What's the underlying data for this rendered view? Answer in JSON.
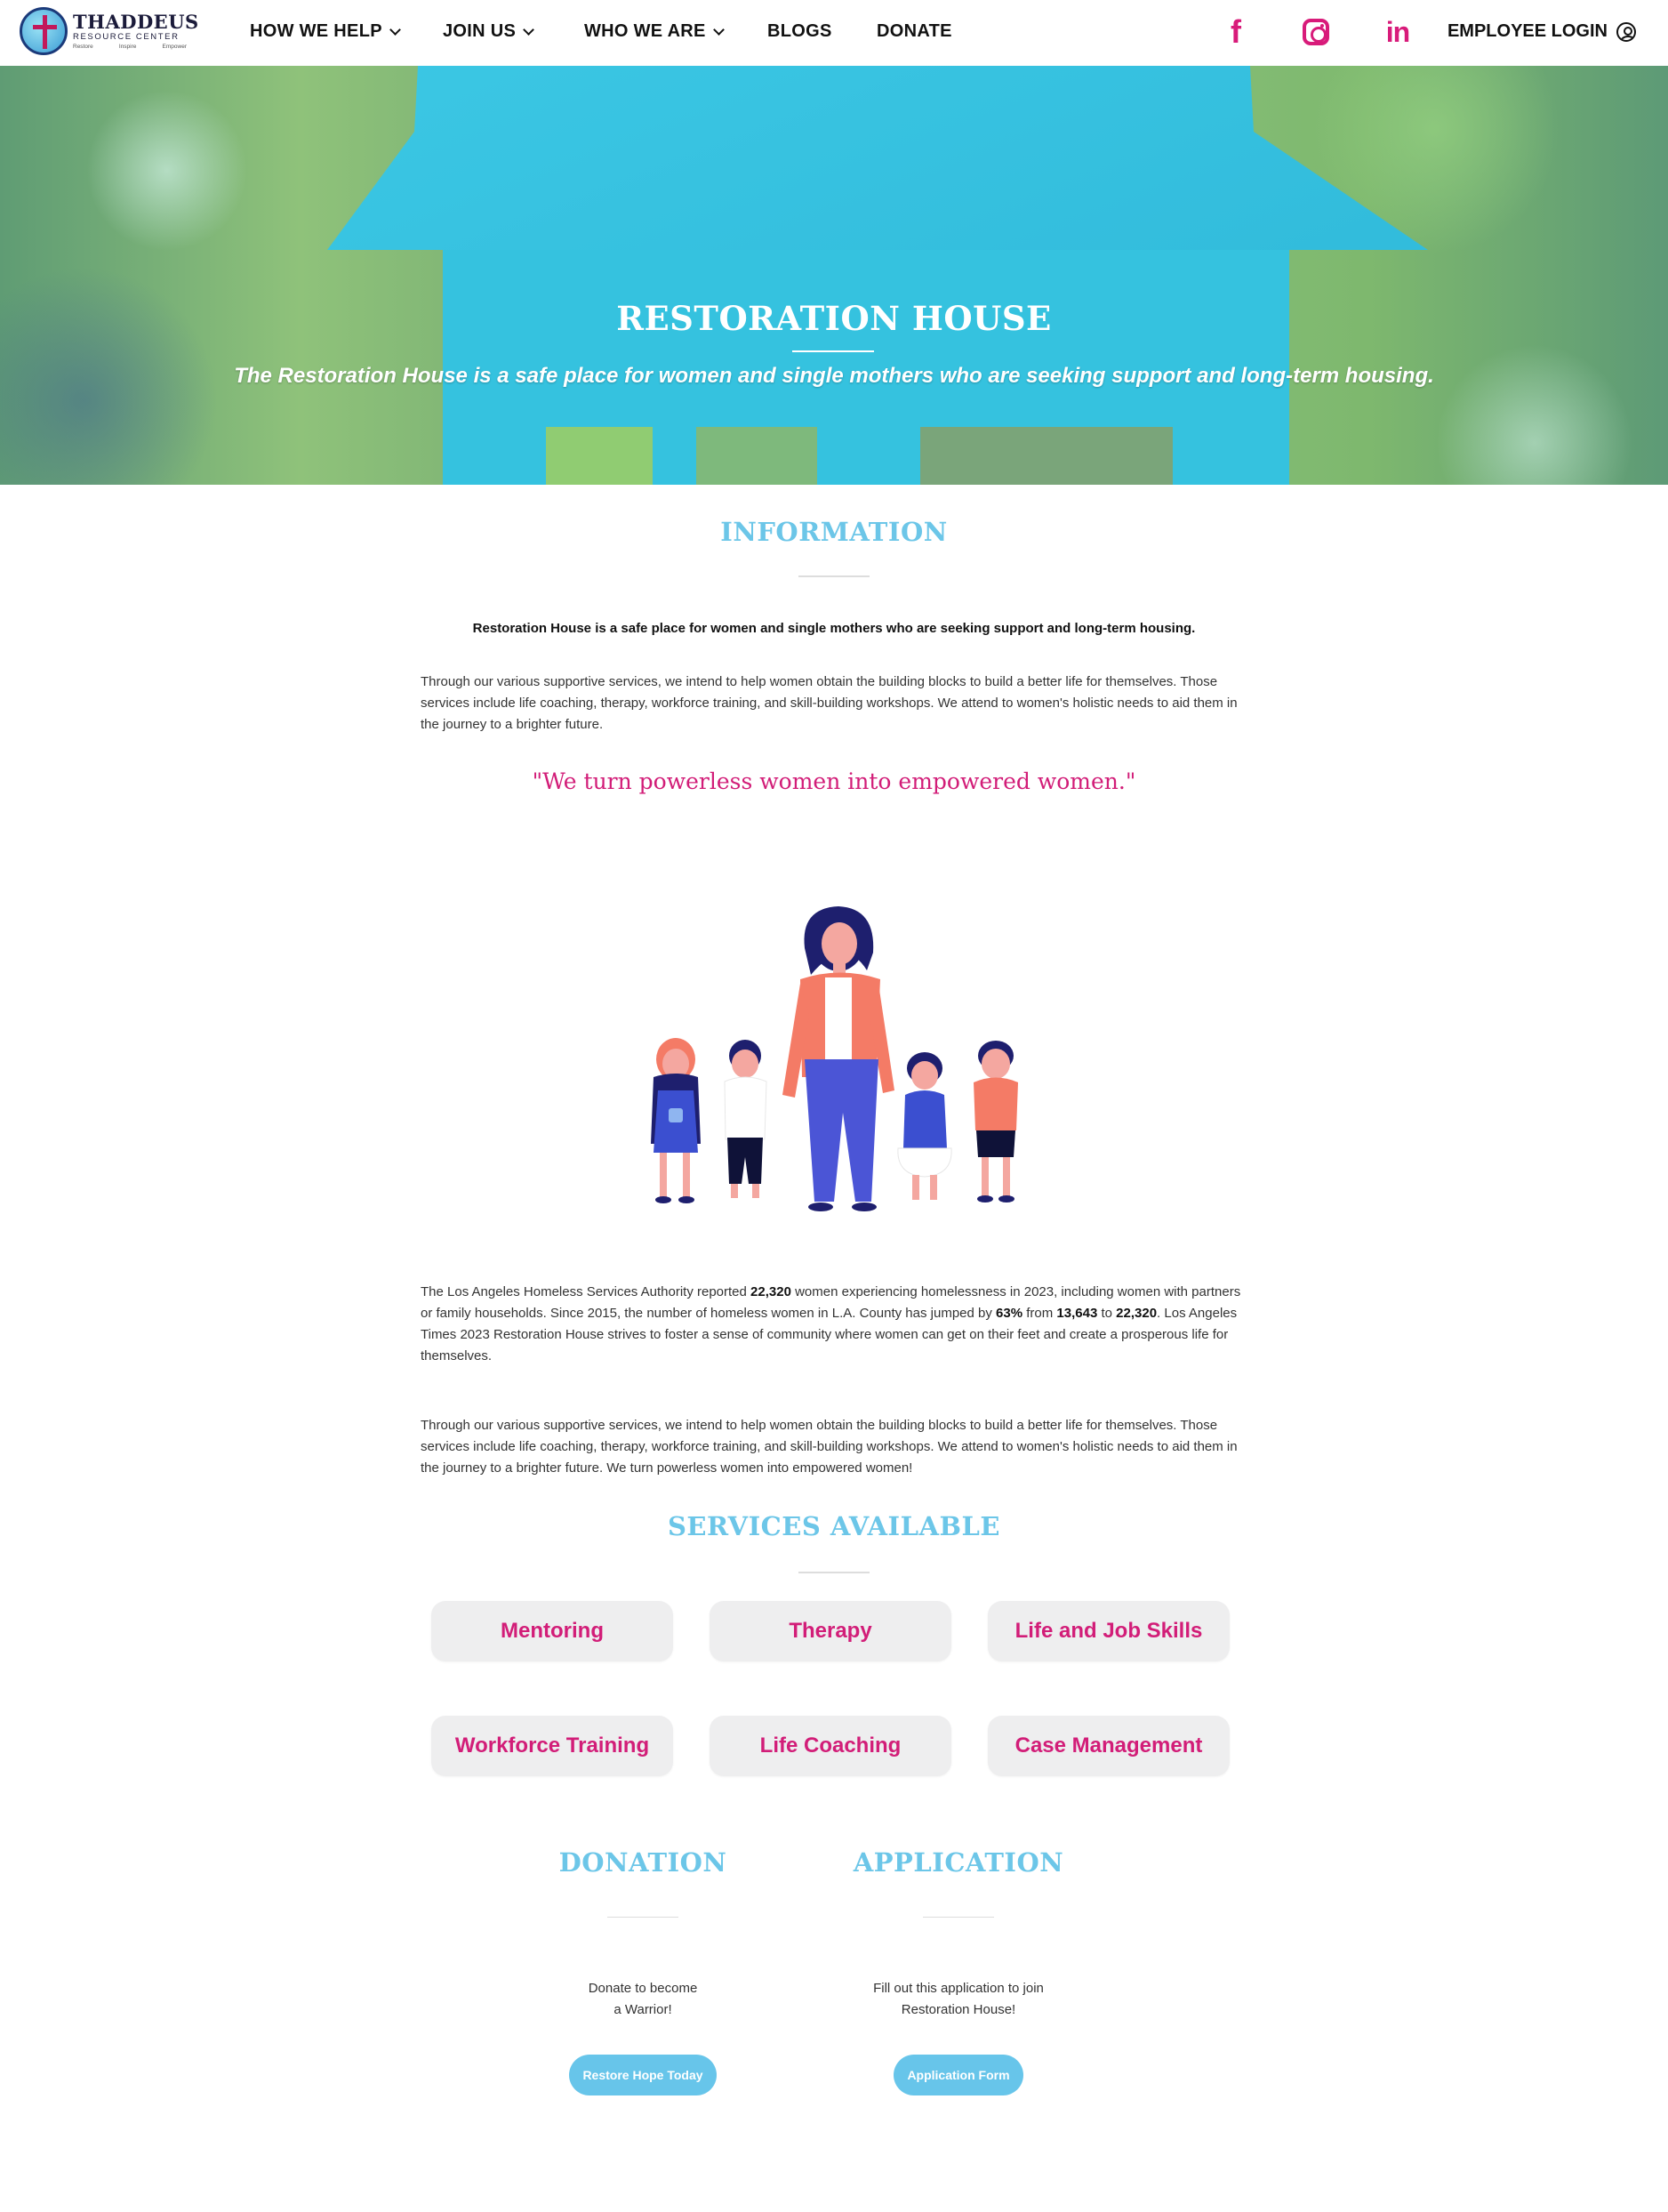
{
  "brand": {
    "title": "THADDEUS",
    "subtitle": "RESOURCE CENTER",
    "tag1": "Restore",
    "tag2": "Inspire",
    "tag3": "Empower"
  },
  "nav": {
    "items": [
      {
        "label": "HOW WE HELP"
      },
      {
        "label": "JOIN US"
      },
      {
        "label": "WHO WE ARE"
      },
      {
        "label": "BLOGS"
      },
      {
        "label": "DONATE"
      }
    ],
    "social": [
      "facebook-icon",
      "instagram-icon",
      "linkedin-icon"
    ],
    "login_label": "EMPLOYEE LOGIN"
  },
  "hero": {
    "title": "RESTORATION HOUSE",
    "subtitle": "The Restoration House is a safe place for women and single mothers who are seeking support and long-term housing."
  },
  "information": {
    "title": "INFORMATION",
    "lead": "Restoration House is a safe place for women and single mothers who are seeking support and long-term housing.",
    "para1": "Through our various supportive services, we intend to help women obtain the building blocks to build a better life for themselves. Those services include life coaching, therapy, workforce training, and skill-building workshops. We attend to women's holistic needs to aid them in the journey to a brighter future.",
    "quote": "\"We turn powerless women into empowered women.\"",
    "stats": {
      "t1": "The Los Angeles Homeless Services Authority reported ",
      "n1": "22,320",
      "t2": " women experiencing homelessness in 2023, including women with partners or family households. Since 2015, the number of homeless women in L.A. County has jumped by ",
      "n2": "63%",
      "t3": " from ",
      "n3": "13,643",
      "t4": " to ",
      "n4": "22,320",
      "t5": ". Los Angeles Times 2023 Restoration House strives to foster a sense of community where women can get on their feet and create a prosperous life for themselves."
    },
    "para3": "Through our various supportive services, we intend to help women obtain the building blocks to build a better life for themselves. Those services include life coaching, therapy, workforce training, and skill-building workshops. We attend to women's holistic needs to aid them in the journey to a brighter future. We turn powerless women into empowered women!"
  },
  "services": {
    "title": "SERVICES AVAILABLE",
    "items": [
      "Mentoring",
      "Therapy",
      "Life and Job Skills",
      "Workforce Training",
      "Life Coaching",
      "Case Management"
    ]
  },
  "donation": {
    "title": "DONATION",
    "line1": "Donate to become",
    "line2": "a Warrior!",
    "button": "Restore Hope Today"
  },
  "application": {
    "title": "APPLICATION",
    "line1": "Fill out this application to join",
    "line2": "Restoration House!",
    "button": "Application Form"
  },
  "colors": {
    "accent_blue": "#6cc6e8",
    "accent_pink": "#d21d78",
    "hero_house": "#35c2df",
    "button_blue": "#67c5ea"
  }
}
